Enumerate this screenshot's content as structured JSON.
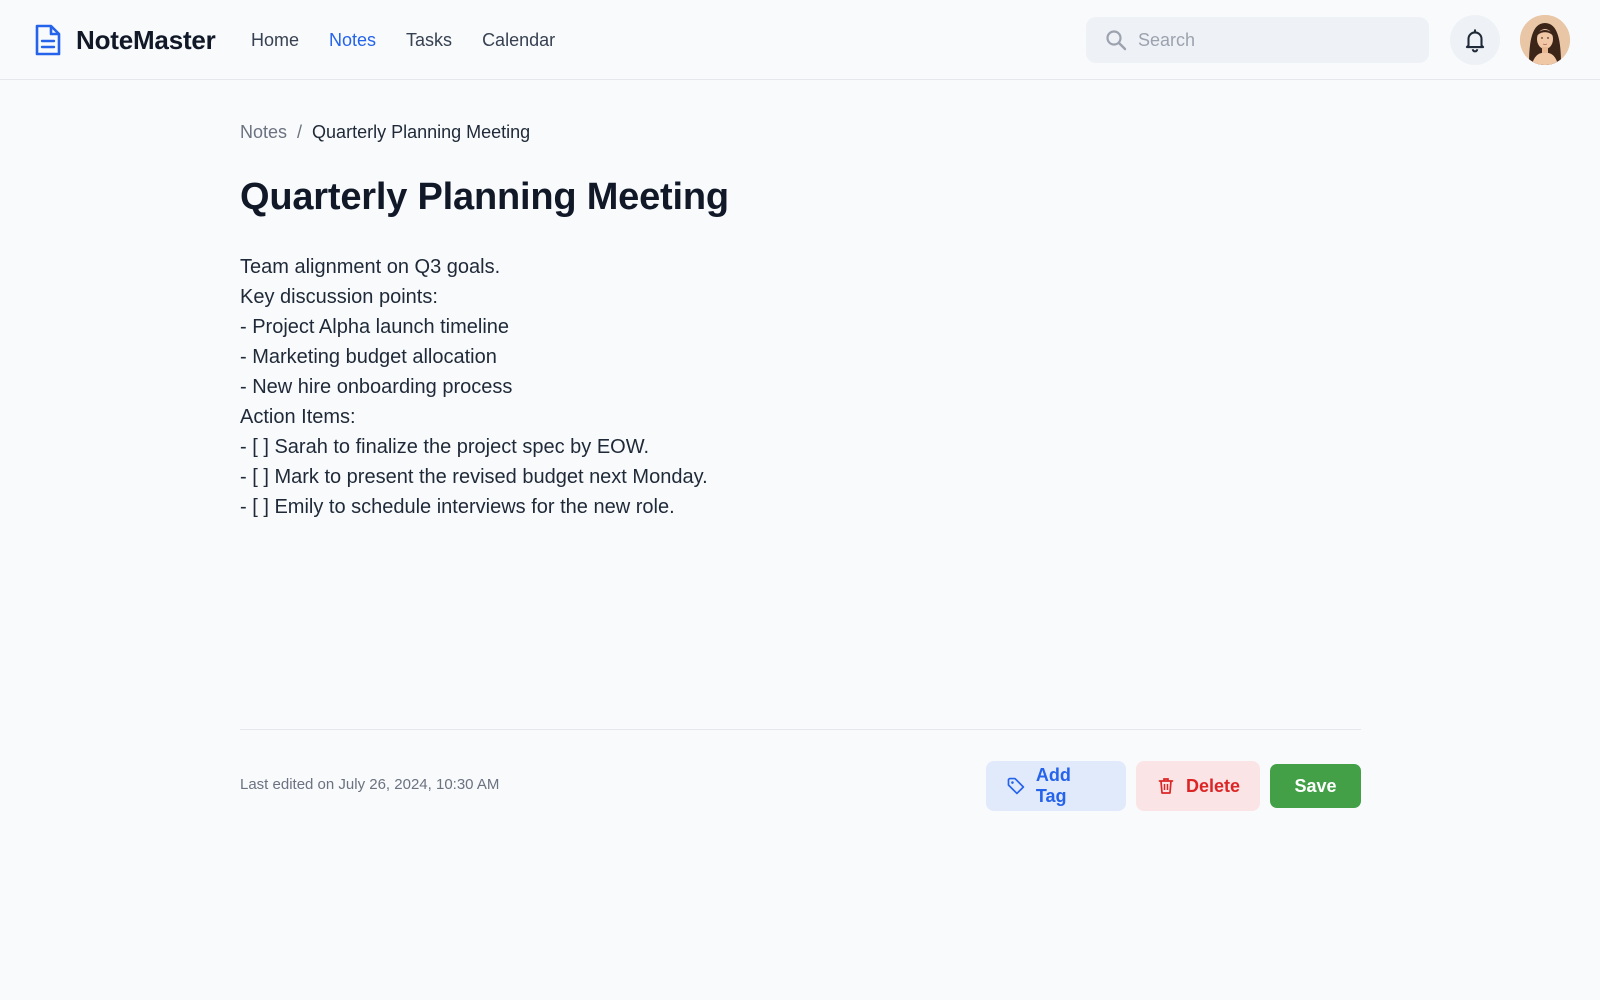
{
  "app": {
    "name": "NoteMaster"
  },
  "nav": {
    "items": [
      {
        "label": "Home",
        "active": false
      },
      {
        "label": "Notes",
        "active": true
      },
      {
        "label": "Tasks",
        "active": false
      },
      {
        "label": "Calendar",
        "active": false
      }
    ]
  },
  "search": {
    "placeholder": "Search",
    "value": ""
  },
  "header_icons": {
    "notifications": "bell-icon",
    "avatar": "user-avatar"
  },
  "breadcrumb": {
    "parent": "Notes",
    "separator": "/",
    "current": "Quarterly Planning Meeting"
  },
  "note": {
    "title": "Quarterly Planning Meeting",
    "body_lines": [
      "Team alignment on Q3 goals.",
      "Key discussion points:",
      "- Project Alpha launch timeline",
      "- Marketing budget allocation",
      "- New hire onboarding process",
      "Action Items:",
      "- [ ] Sarah to finalize the project spec by EOW.",
      "- [ ] Mark to present the revised budget next Monday.",
      "- [ ] Emily to schedule interviews for the new role."
    ],
    "last_edited": "Last edited on July 26, 2024, 10:30 AM"
  },
  "actions": {
    "add_tag": "Add Tag",
    "delete": "Delete",
    "save": "Save"
  },
  "colors": {
    "accent": "#2563eb",
    "danger": "#dc2626",
    "success": "#43a047",
    "background": "#f8fafc"
  }
}
